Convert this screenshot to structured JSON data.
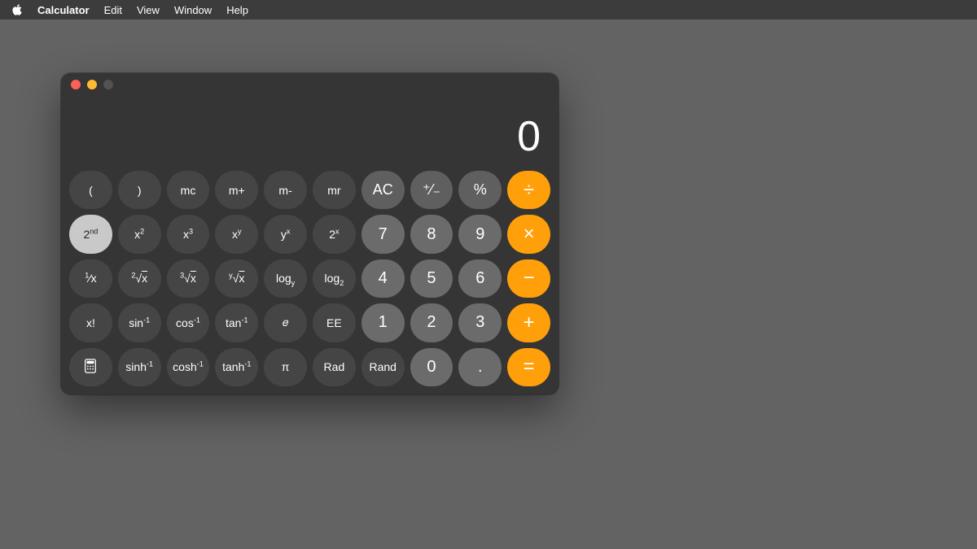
{
  "menubar": {
    "app_name": "Calculator",
    "items": [
      "Edit",
      "View",
      "Window",
      "Help"
    ]
  },
  "display": {
    "value": "0"
  },
  "keys": {
    "lparen": "(",
    "rparen": ")",
    "mc": "mc",
    "mplus": "m+",
    "mminus": "m-",
    "mr": "mr",
    "ac": "AC",
    "sign": "⁺⁄₋",
    "percent": "%",
    "divide": "÷",
    "second_base": "2",
    "second_sup": "nd",
    "x2_base": "x",
    "x2_sup": "2",
    "x3_base": "x",
    "x3_sup": "3",
    "xy_base": "x",
    "xy_sup": "y",
    "yx_base": "y",
    "yx_sup": "x",
    "two_x_base": "2",
    "two_x_sup": "x",
    "n7": "7",
    "n8": "8",
    "n9": "9",
    "multiply": "×",
    "recip_sup": "1",
    "recip_base": "x",
    "root2_sup": "2",
    "root2_rad": "√",
    "root2_x": "x",
    "root3_sup": "3",
    "root3_rad": "√",
    "root3_x": "x",
    "rooty_sup": "y",
    "rooty_rad": "√",
    "rooty_x": "x",
    "logy_base": "log",
    "logy_sub": "y",
    "log2_base": "log",
    "log2_sub": "2",
    "n4": "4",
    "n5": "5",
    "n6": "6",
    "minus": "−",
    "fact": "x!",
    "asin_base": "sin",
    "asin_sup": "-1",
    "acos_base": "cos",
    "acos_sup": "-1",
    "atan_base": "tan",
    "atan_sup": "-1",
    "e": "𝑒",
    "ee": "EE",
    "n1": "1",
    "n2": "2",
    "n3": "3",
    "plus": "+",
    "asinh_base": "sinh",
    "asinh_sup": "-1",
    "acosh_base": "cosh",
    "acosh_sup": "-1",
    "atanh_base": "tanh",
    "atanh_sup": "-1",
    "pi": "π",
    "rad": "Rad",
    "rand": "Rand",
    "n0": "0",
    "dot": ".",
    "equals": "="
  }
}
